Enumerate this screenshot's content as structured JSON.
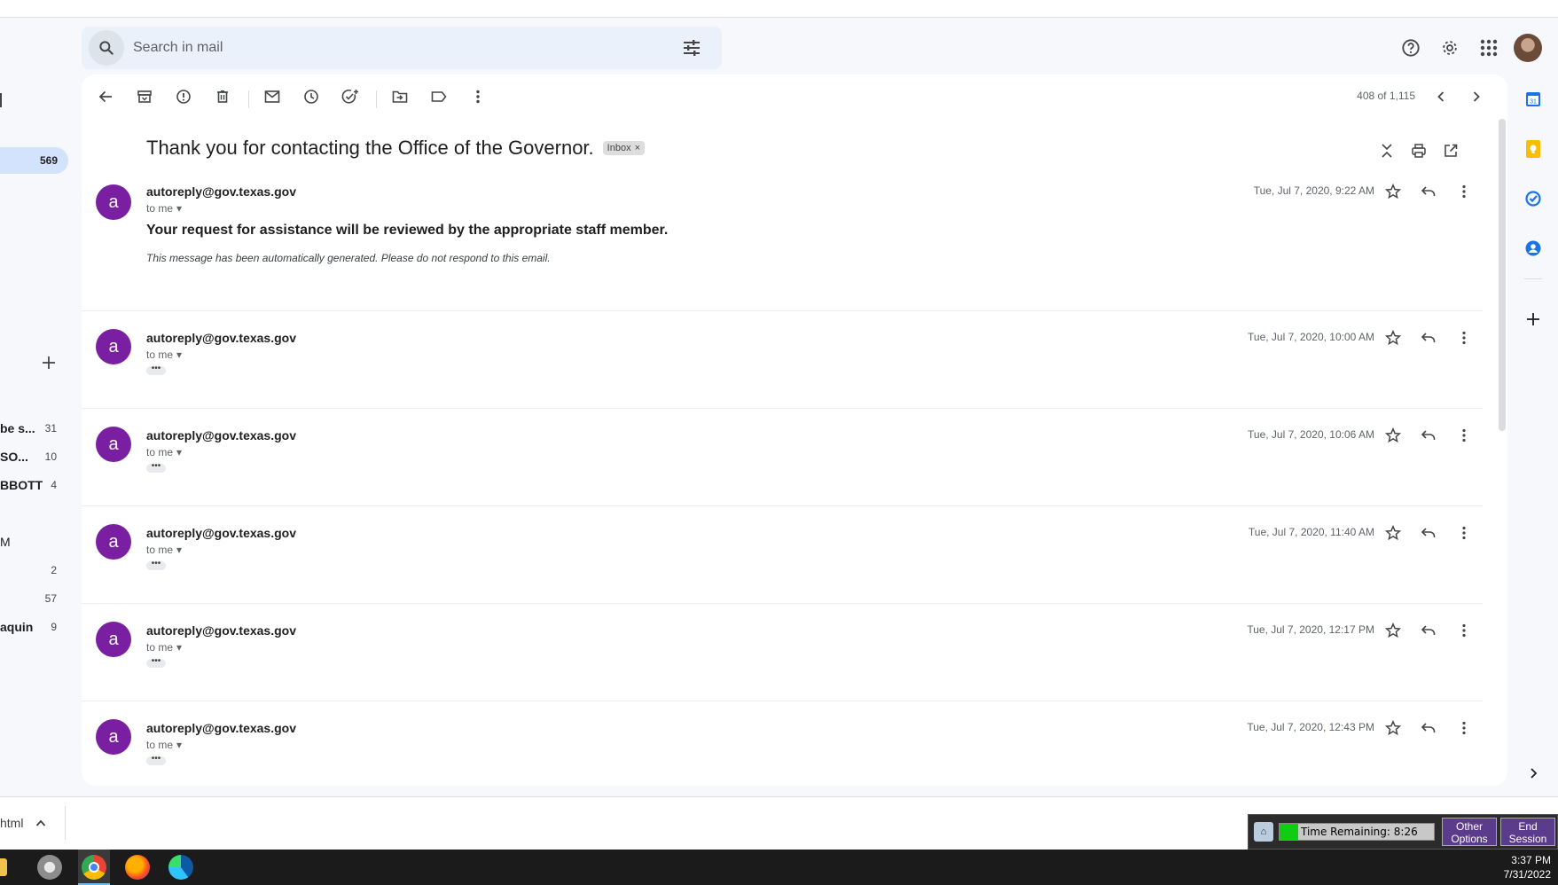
{
  "search": {
    "placeholder": "Search in mail"
  },
  "sidebar": {
    "active_count": "569",
    "rows": [
      {
        "label": "be s...",
        "count": "31"
      },
      {
        "label": "SO...",
        "count": "10"
      },
      {
        "label": "BBOTT",
        "count": "4"
      },
      {
        "label": "M",
        "count": ""
      },
      {
        "label": "",
        "count": "2"
      },
      {
        "label": "",
        "count": "57"
      },
      {
        "label": "aquin",
        "count": "9"
      }
    ]
  },
  "toolbar": {
    "pager": "408 of 1,115"
  },
  "thread": {
    "subject": "Thank you for contacting the Office of the Governor.",
    "label_chip": "Inbox",
    "messages": [
      {
        "avatar": "a",
        "from": "autoreply@gov.texas.gov",
        "to": "to me",
        "date": "Tue, Jul 7, 2020, 9:22 AM",
        "body": "Your request for assistance will be reviewed by the appropriate staff member.",
        "note": "This message has been automatically generated. Please do not respond to this email."
      },
      {
        "avatar": "a",
        "from": "autoreply@gov.texas.gov",
        "to": "to me",
        "date": "Tue, Jul 7, 2020, 10:00 AM"
      },
      {
        "avatar": "a",
        "from": "autoreply@gov.texas.gov",
        "to": "to me",
        "date": "Tue, Jul 7, 2020, 10:06 AM"
      },
      {
        "avatar": "a",
        "from": "autoreply@gov.texas.gov",
        "to": "to me",
        "date": "Tue, Jul 7, 2020, 11:40 AM"
      },
      {
        "avatar": "a",
        "from": "autoreply@gov.texas.gov",
        "to": "to me",
        "date": "Tue, Jul 7, 2020, 12:17 PM"
      },
      {
        "avatar": "a",
        "from": "autoreply@gov.texas.gov",
        "to": "to me",
        "date": "Tue, Jul 7, 2020, 12:43 PM"
      }
    ]
  },
  "download": {
    "filename": "html"
  },
  "session": {
    "time_remaining": "Time Remaining: 8:26",
    "time_fraction": 0.12,
    "other_options": "Other Options",
    "end_session": "End Session"
  },
  "taskbar": {
    "time": "3:37 PM",
    "date": "7/31/2022"
  },
  "colors": {
    "avatar": "#7b1fa2",
    "active_nav": "#d3e3fd",
    "accent": "#1a73e8"
  },
  "icons": {
    "toolbar": [
      "back-arrow-icon",
      "archive-icon",
      "report-spam-icon",
      "delete-icon",
      "mark-unread-icon",
      "snooze-icon",
      "add-task-icon",
      "move-to-icon",
      "label-icon",
      "more-vert-icon"
    ],
    "header": [
      "help-icon",
      "settings-icon",
      "apps-grid-icon"
    ],
    "side_panel": [
      "calendar-icon",
      "keep-icon",
      "tasks-icon",
      "contacts-icon",
      "add-icon"
    ]
  }
}
